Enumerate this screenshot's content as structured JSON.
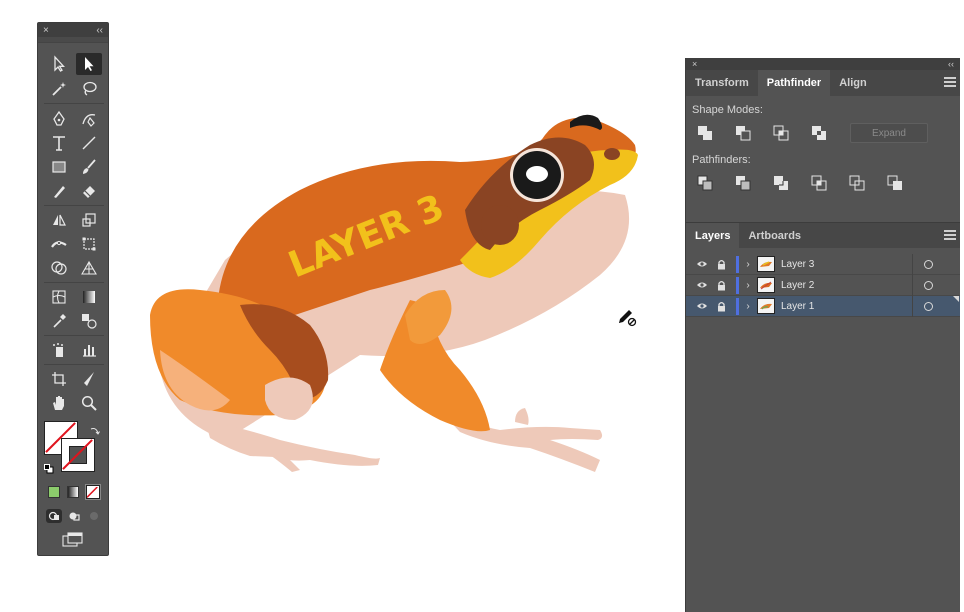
{
  "tools_panel": {
    "close_glyph": "×",
    "collapse_glyph": "‹‹",
    "tools": [
      "selection-tool",
      "direct-selection-tool",
      "magic-wand-tool",
      "lasso-tool",
      "pen-tool",
      "curvature-tool",
      "type-tool",
      "line-tool",
      "rectangle-tool",
      "paintbrush-tool",
      "shaper-tool",
      "eraser-tool",
      "reflect-tool",
      "scale-tool",
      "width-tool",
      "free-transform-tool",
      "shape-builder-tool",
      "perspective-grid-tool",
      "mesh-tool",
      "gradient-tool",
      "eyedropper-tool",
      "blend-tool",
      "symbol-sprayer-tool",
      "column-graph-tool",
      "artboard-tool",
      "slice-tool",
      "hand-tool",
      "zoom-tool"
    ],
    "fill_stroke": {
      "fill": "none",
      "stroke": "none"
    },
    "color_modes": [
      "color",
      "gradient",
      "none"
    ],
    "draw_modes": [
      "draw-normal",
      "draw-behind",
      "draw-inside"
    ],
    "screen_mode": "change-screen-mode"
  },
  "canvas": {
    "artwork_text": "LAYER 3",
    "cursor": "pencil-locked-cursor",
    "colors": {
      "body_orange": "#d9691e",
      "belly": "#eec9b9",
      "light_orange": "#f08a2a",
      "yellow": "#f2c11b",
      "dark_brown": "#8a4423"
    }
  },
  "pathfinder_panel": {
    "close_glyph": "×",
    "collapse_glyph": "‹‹",
    "tabs": [
      "Transform",
      "Pathfinder",
      "Align"
    ],
    "active_tab": "Pathfinder",
    "shape_modes_label": "Shape Modes:",
    "shape_modes": [
      "unite",
      "minus-front",
      "intersect",
      "exclude"
    ],
    "expand_label": "Expand",
    "pathfinders_label": "Pathfinders:",
    "pathfinders": [
      "divide",
      "trim",
      "merge",
      "crop",
      "outline",
      "minus-back"
    ]
  },
  "layers_panel": {
    "tabs": [
      "Layers",
      "Artboards"
    ],
    "active_tab": "Layers",
    "layers": [
      {
        "name": "Layer 3",
        "visible": true,
        "locked": true,
        "selected": false
      },
      {
        "name": "Layer 2",
        "visible": true,
        "locked": true,
        "selected": false
      },
      {
        "name": "Layer 1",
        "visible": true,
        "locked": true,
        "selected": true
      }
    ],
    "layer_color": "#4f6fe0",
    "selection_color": "#46586e"
  }
}
